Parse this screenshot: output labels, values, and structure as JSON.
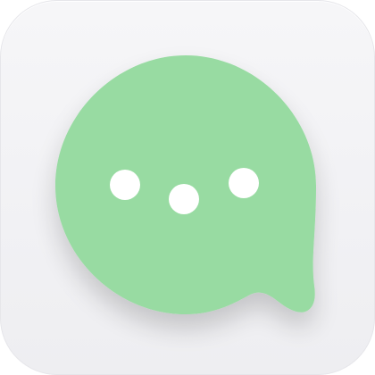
{
  "app_icon": {
    "icon": "chat-bubble-icon",
    "dots_icon": "ellipsis-dots-icon",
    "dot_count": 3,
    "colors": {
      "tile_background": "#f3f3f6",
      "tile_border": "#e6e6ea",
      "bubble_fill": "#98dba2",
      "dot_fill": "#ffffff"
    }
  }
}
